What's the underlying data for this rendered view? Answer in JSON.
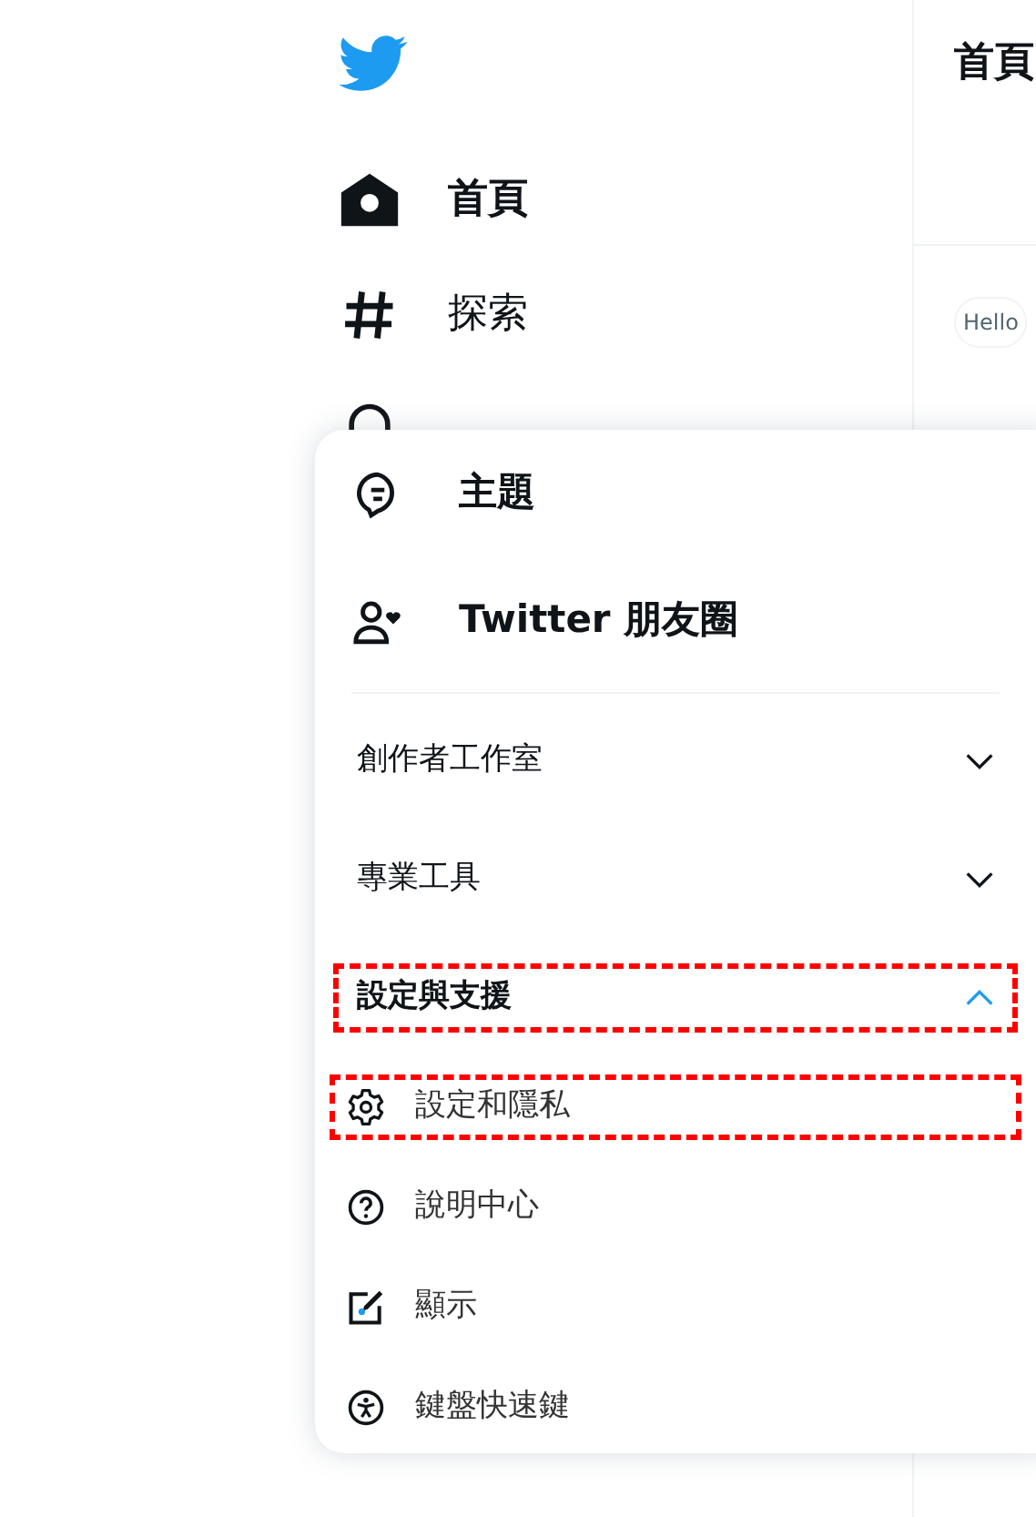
{
  "sidebar": {
    "items": [
      {
        "kind": "home",
        "label": "首頁",
        "selected": true
      },
      {
        "kind": "hash",
        "label": "探索",
        "selected": false
      }
    ]
  },
  "main": {
    "header": "首頁",
    "composer_hint": "Hello"
  },
  "menu": {
    "top_items": [
      {
        "kind": "topic",
        "label": "主題"
      },
      {
        "kind": "circle",
        "label": "Twitter 朋友圈"
      }
    ],
    "sections": [
      {
        "label": "創作者工作室",
        "expanded": false,
        "highlighted": false
      },
      {
        "label": "專業工具",
        "expanded": false,
        "highlighted": false
      },
      {
        "label": "設定與支援",
        "expanded": true,
        "highlighted": true,
        "children": [
          {
            "kind": "gear",
            "label": "設定和隱私",
            "highlighted": true
          },
          {
            "kind": "help",
            "label": "說明中心",
            "highlighted": false
          },
          {
            "kind": "display",
            "label": "顯示",
            "highlighted": false
          },
          {
            "kind": "access",
            "label": "鍵盤快速鍵",
            "highlighted": false
          }
        ]
      }
    ]
  }
}
